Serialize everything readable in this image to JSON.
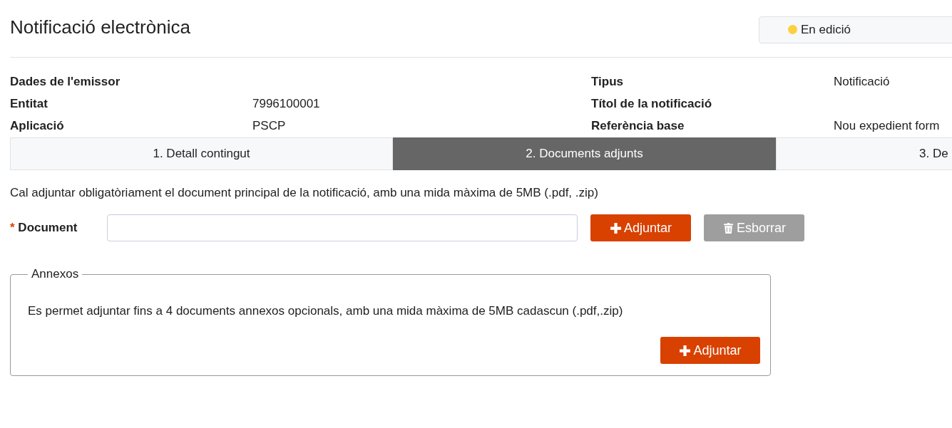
{
  "header": {
    "title": "Notificació electrònica",
    "status": {
      "label": "En edició",
      "color": "#fcd03f"
    }
  },
  "details": {
    "left": [
      {
        "label": "Dades de l'emissor"
      },
      {
        "label": "Entitat",
        "value": "7996100001"
      },
      {
        "label": "Aplicació",
        "value": "PSCP"
      }
    ],
    "right": [
      {
        "label": "Tipus",
        "value": "Notificació"
      },
      {
        "label": "Títol de la notificació"
      },
      {
        "label": "Referència base",
        "value": "Nou expedient form"
      }
    ]
  },
  "tabs": [
    {
      "label": "1. Detall contingut",
      "selected": false
    },
    {
      "label": "2. Documents adjunts",
      "selected": true
    },
    {
      "label": "3. De",
      "selected": false
    }
  ],
  "intro": "Cal adjuntar obligatòriament el document principal de la notificació, amb una mida màxima de 5MB (.pdf, .zip)",
  "document": {
    "label": "Document",
    "required": true,
    "required_mark": "*",
    "buttons": [
      {
        "kind": "add",
        "label": "Adjuntar",
        "disabled": false
      },
      {
        "kind": "delete",
        "label": "Esborrar",
        "disabled": true
      }
    ]
  },
  "annexes": {
    "legend": "Annexos",
    "text": "Es permet adjuntar fins a 4 documents annexos opcionals, amb una mida màxima de 5MB cadascun (.pdf,.zip)",
    "buttons": [
      {
        "kind": "add",
        "label": "Adjuntar",
        "disabled": false
      }
    ]
  }
}
